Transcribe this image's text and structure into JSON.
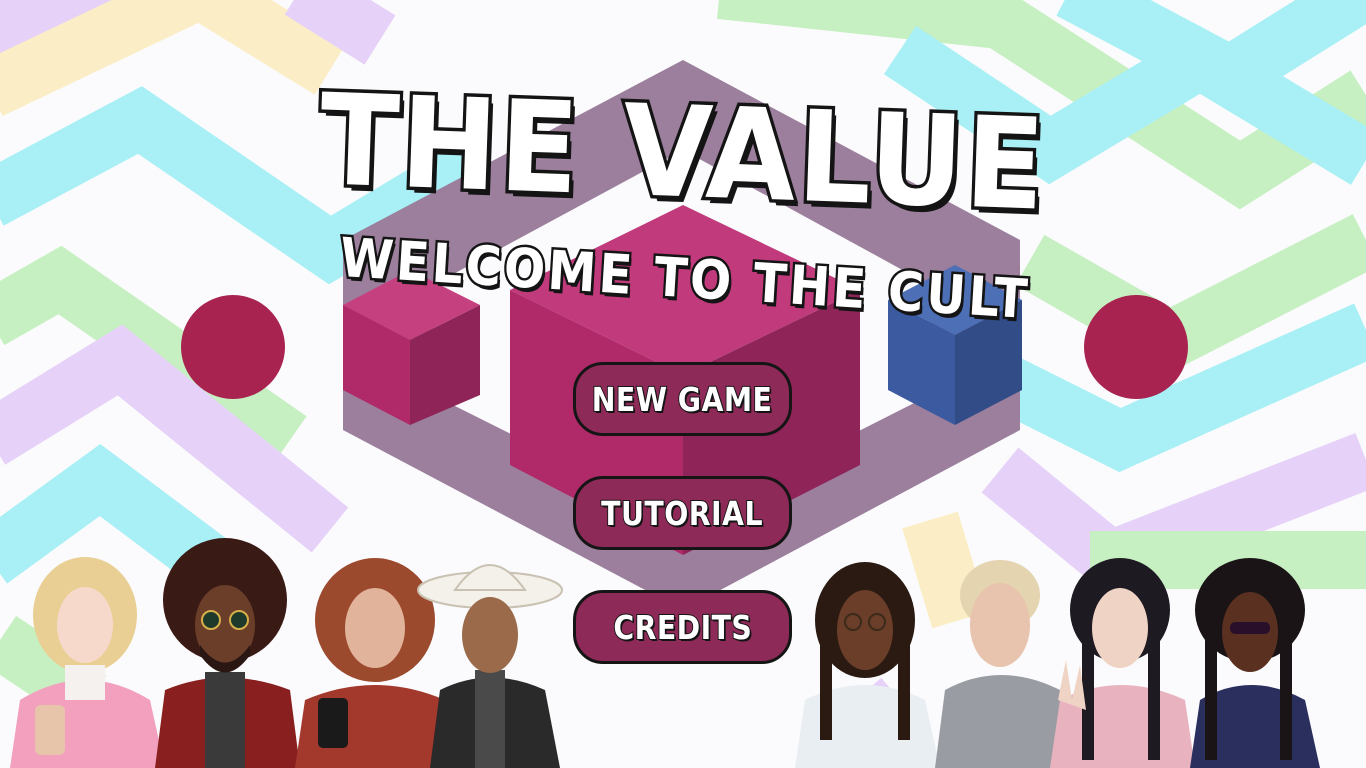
{
  "game": {
    "title": "THE VALUE",
    "subtitle": "WELCOME TO THE CULT"
  },
  "menu": {
    "new_game": "NEW GAME",
    "tutorial": "TUTORIAL",
    "credits": "CREDITS"
  },
  "colors": {
    "button_fill": "#8e2a58",
    "button_border": "#151515",
    "cube_magenta": "#b02a6a",
    "cube_blue": "#3b5aa0",
    "hex_frame": "#9b7f9c",
    "orb": "#a8234f",
    "stripe_cyan": "#a8f0f5",
    "stripe_green": "#c7f0c2",
    "stripe_purple": "#e6d1f8",
    "stripe_yellow": "#fbeec6"
  },
  "characters": [
    "blonde-woman-with-bubble-tea",
    "man-with-afro-and-sunglasses",
    "woman-with-phone",
    "man-in-cowboy-hat",
    "man-with-locs-and-glasses",
    "blond-man-in-hoodie",
    "woman-with-braids-peace-sign",
    "woman-with-braids-and-sunglasses"
  ]
}
